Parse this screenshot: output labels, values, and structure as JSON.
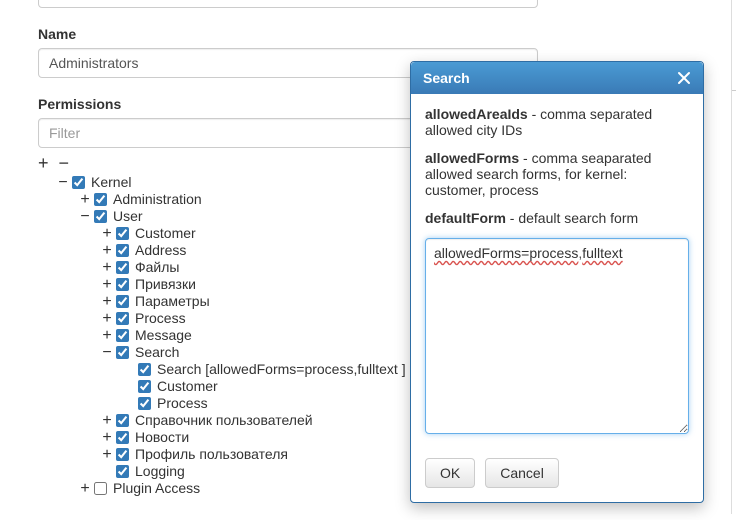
{
  "name_section": {
    "label": "Name",
    "value": "Administrators"
  },
  "permissions_section": {
    "label": "Permissions",
    "filter_placeholder": "Filter"
  },
  "toolbar": {
    "expand_all": "+",
    "collapse_all": "−"
  },
  "tree": {
    "kernel": "Kernel",
    "administration": "Administration",
    "user": "User",
    "customer": "Customer",
    "address": "Address",
    "files": "Файлы",
    "bindings": "Привязки",
    "parameters": "Параметры",
    "process": "Process",
    "message": "Message",
    "search": "Search",
    "search_config": "Search [allowedForms=process,fulltext ]",
    "search_customer": "Customer",
    "search_process": "Process",
    "user_directory": "Справочник пользователей",
    "news": "Новости",
    "user_profile": "Профиль пользователя",
    "logging": "Logging",
    "plugin_access": "Plugin Access"
  },
  "dialog": {
    "title": "Search",
    "params": [
      {
        "name": "allowedAreaIds",
        "desc": " - comma separated allowed city IDs"
      },
      {
        "name": "allowedForms",
        "desc": " - comma seaparated allowed search forms, for kernel: customer, process"
      },
      {
        "name": "defaultForm",
        "desc": " - default search form"
      }
    ],
    "value_tokens": [
      "allowedForms=process",
      ",",
      "fulltext"
    ],
    "ok_label": "OK",
    "cancel_label": "Cancel"
  }
}
